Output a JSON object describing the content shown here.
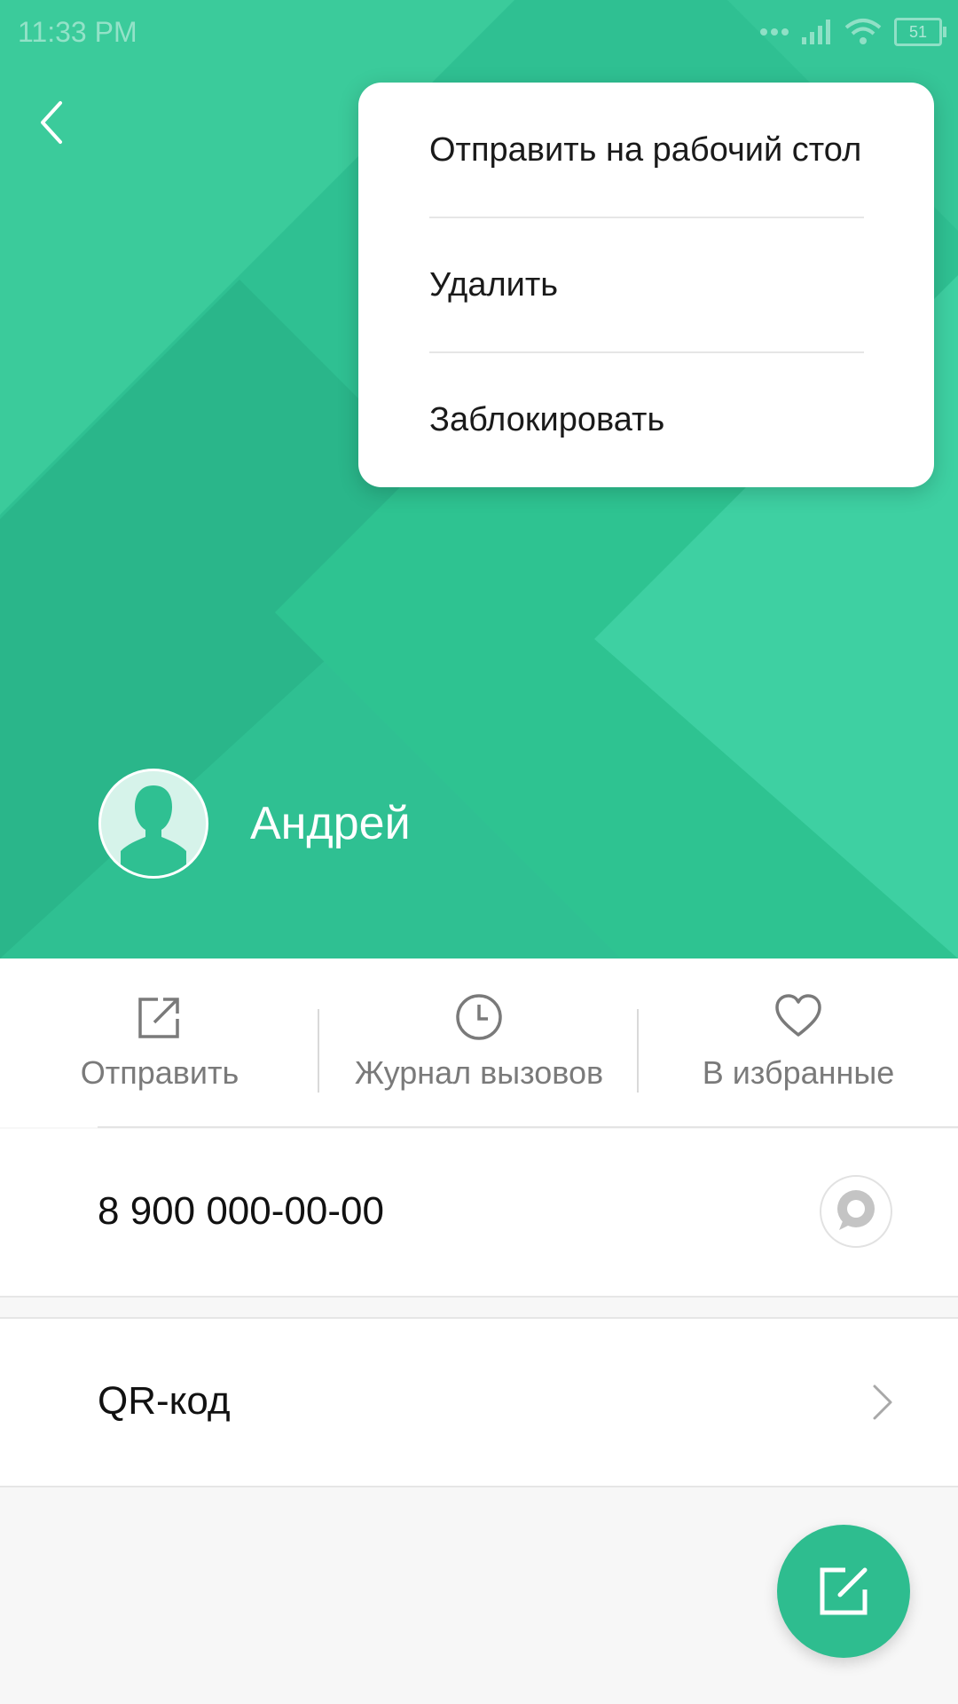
{
  "status_bar": {
    "time": "11:33 PM",
    "battery_level": "51"
  },
  "header": {
    "contact_name": "Андрей"
  },
  "menu": {
    "items": [
      "Отправить на рабочий стол",
      "Удалить",
      "Заблокировать"
    ]
  },
  "actions": [
    {
      "label": "Отправить",
      "icon": "share-icon"
    },
    {
      "label": "Журнал вызовов",
      "icon": "clock-icon"
    },
    {
      "label": "В избранные",
      "icon": "heart-icon"
    }
  ],
  "phone": {
    "number": "8 900 000-00-00"
  },
  "qr": {
    "label": "QR-код"
  },
  "colors": {
    "accent": "#2fc092",
    "header_light": "#3fd3a4",
    "header_dark": "#27b487"
  }
}
